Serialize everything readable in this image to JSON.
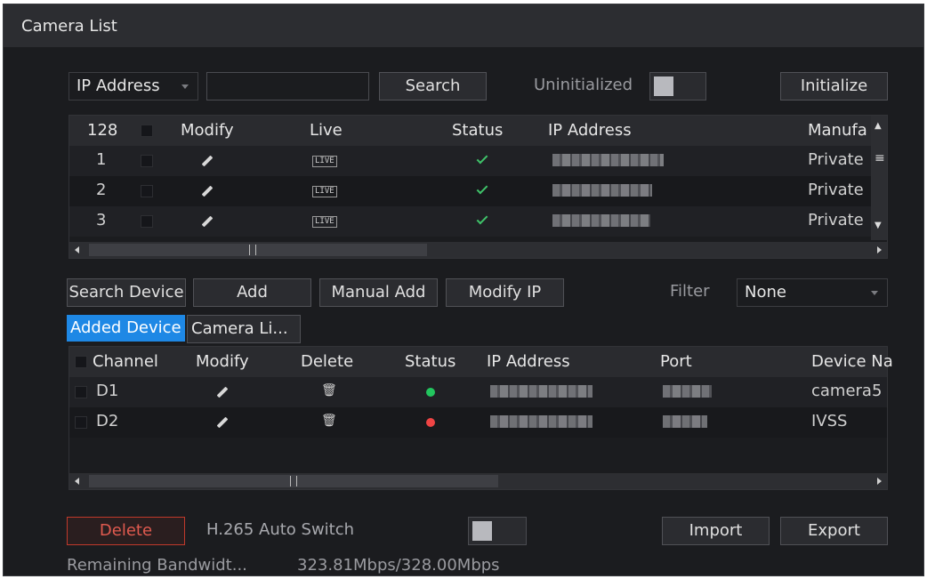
{
  "window": {
    "title": "Camera List"
  },
  "search_bar": {
    "filter_type": "IP Address",
    "search_value": "",
    "search_label": "Search",
    "uninitialized_label": "Uninitialized",
    "uninitialized_toggle_on": false,
    "initialize_label": "Initialize"
  },
  "found_devices": {
    "count_header": "128",
    "columns": [
      "Modify",
      "Live",
      "Status",
      "IP Address",
      "Manufa"
    ],
    "rows": [
      {
        "num": "1",
        "live": "LIVE",
        "ip": "",
        "manufacturer": "Private"
      },
      {
        "num": "2",
        "live": "LIVE",
        "ip": "",
        "manufacturer": "Private"
      },
      {
        "num": "3",
        "live": "LIVE",
        "ip": "",
        "manufacturer": "Private"
      }
    ]
  },
  "actions": {
    "search_device": "Search Device",
    "add": "Add",
    "manual_add": "Manual Add",
    "modify_ip": "Modify IP",
    "filter_label": "Filter",
    "filter_value": "None"
  },
  "tabs": {
    "added_device": "Added Device",
    "camera_list": "Camera Li..."
  },
  "added_devices": {
    "columns": [
      "Channel",
      "Modify",
      "Delete",
      "Status",
      "IP Address",
      "Port",
      "Device Na"
    ],
    "rows": [
      {
        "channel": "D1",
        "status_color": "#22c55e",
        "device_name": "camera5"
      },
      {
        "channel": "D2",
        "status_color": "#ef4444",
        "device_name": "IVSS"
      }
    ]
  },
  "footer": {
    "delete": "Delete",
    "h265_label": "H.265 Auto Switch",
    "h265_toggle_on": false,
    "import": "Import",
    "export": "Export",
    "bandwidth_label": "Remaining Bandwidt...",
    "bandwidth_value": "323.81Mbps/328.00Mbps"
  },
  "colors": {
    "accent_tab": "#1e88e5",
    "delete_border": "#c0392b",
    "delete_text": "#e05a4f"
  }
}
